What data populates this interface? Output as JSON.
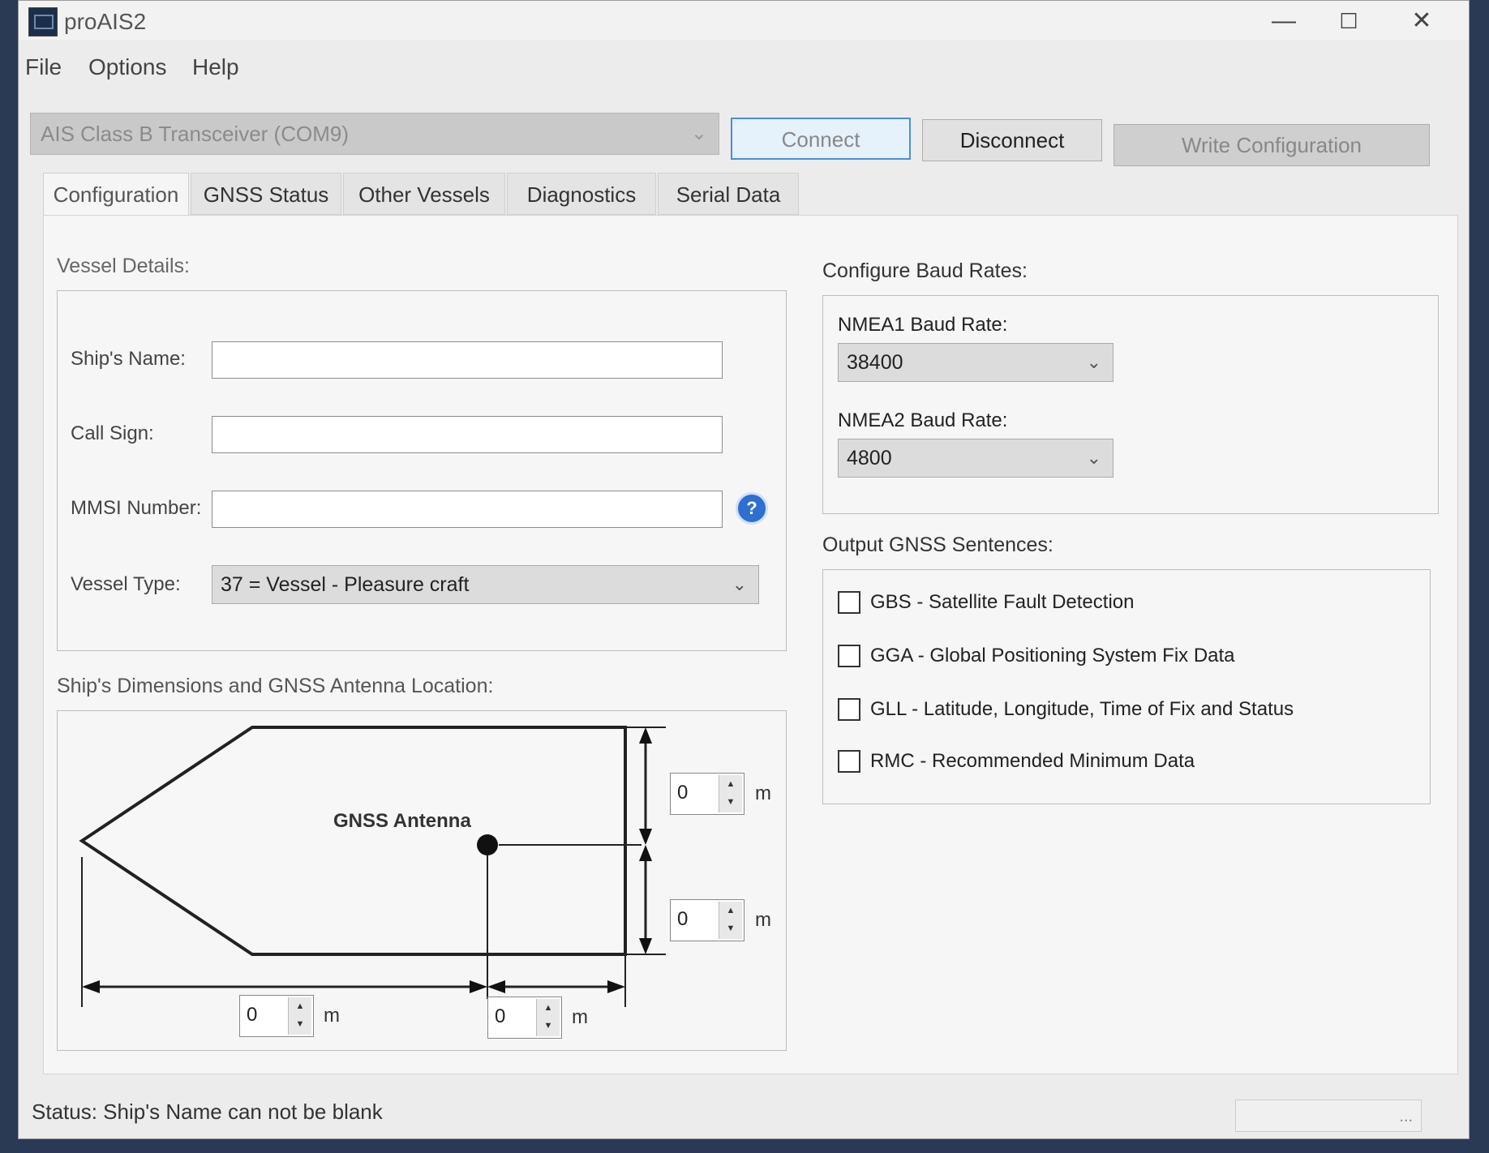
{
  "window": {
    "title": "proAIS2",
    "minimize": "—",
    "maximize": "☐",
    "close": "✕"
  },
  "menu": [
    "File",
    "Options",
    "Help"
  ],
  "toolbar": {
    "device": "AIS Class B Transceiver (COM9)",
    "connect": "Connect",
    "disconnect": "Disconnect",
    "write": "Write Configuration"
  },
  "tabs": [
    "Configuration",
    "GNSS Status",
    "Other Vessels",
    "Diagnostics",
    "Serial Data"
  ],
  "vessel": {
    "group": "Vessel Details:",
    "ship_name_label": "Ship's Name:",
    "ship_name": "",
    "call_sign_label": "Call Sign:",
    "call_sign": "",
    "mmsi_label": "MMSI Number:",
    "mmsi": "",
    "type_label": "Vessel Type:",
    "type": "37 = Vessel - Pleasure craft"
  },
  "dimensions": {
    "group": "Ship's Dimensions and GNSS Antenna Location:",
    "antenna_label": "GNSS Antenna",
    "top": "0",
    "bottom": "0",
    "left": "0",
    "right": "0",
    "unit": "m"
  },
  "baud": {
    "group": "Configure Baud Rates:",
    "nmea1_label": "NMEA1 Baud Rate:",
    "nmea1": "38400",
    "nmea2_label": "NMEA2 Baud Rate:",
    "nmea2": "4800"
  },
  "gnss": {
    "group": "Output GNSS Sentences:",
    "items": [
      "GBS - Satellite Fault Detection",
      "GGA - Global Positioning System Fix Data",
      "GLL  - Latitude, Longitude, Time of Fix and Status",
      "RMC - Recommended Minimum Data"
    ]
  },
  "status": {
    "text": "Status: Ship's Name can not be blank",
    "right": "..."
  }
}
